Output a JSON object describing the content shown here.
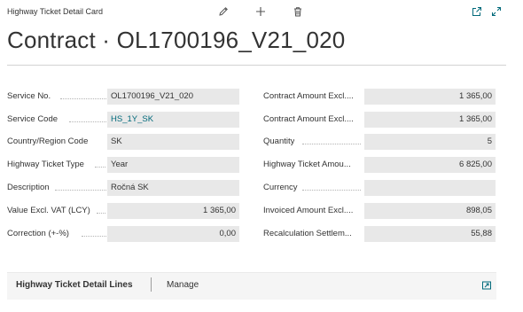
{
  "header": {
    "caption": "Highway Ticket Detail Card",
    "title": "Contract · OL1700196_V21_020",
    "icons": [
      "edit-icon",
      "add-icon",
      "delete-icon",
      "open-new-window-icon",
      "expand-icon"
    ]
  },
  "left_fields": [
    {
      "label": "Service No.",
      "value": "OL1700196_V21_020"
    },
    {
      "label": "Service Code",
      "value": "HS_1Y_SK"
    },
    {
      "label": "Country/Region Code",
      "value": "SK"
    },
    {
      "label": "Highway Ticket Type",
      "value": "Year"
    },
    {
      "label": "Description",
      "value": "Ročná SK"
    },
    {
      "label": "Value Excl. VAT (LCY)",
      "value": "1 365,00"
    },
    {
      "label": "Correction (+-%)",
      "value": "0,00"
    }
  ],
  "right_fields": [
    {
      "label": "Contract Amount Excl....",
      "value": "1 365,00"
    },
    {
      "label": "Contract Amount Excl....",
      "value": "1 365,00"
    },
    {
      "label": "Quantity",
      "value": "5"
    },
    {
      "label": "Highway Ticket Amou...",
      "value": "6 825,00"
    },
    {
      "label": "Currency",
      "value": ""
    },
    {
      "label": "Invoiced Amount Excl....",
      "value": "898,05"
    },
    {
      "label": "Recalculation Settlem...",
      "value": "55,88"
    }
  ],
  "lines": {
    "title": "Highway Ticket Detail Lines",
    "manage_label": "Manage"
  },
  "colors": {
    "accent": "#00697a",
    "field_bg": "#e8e8e8"
  }
}
